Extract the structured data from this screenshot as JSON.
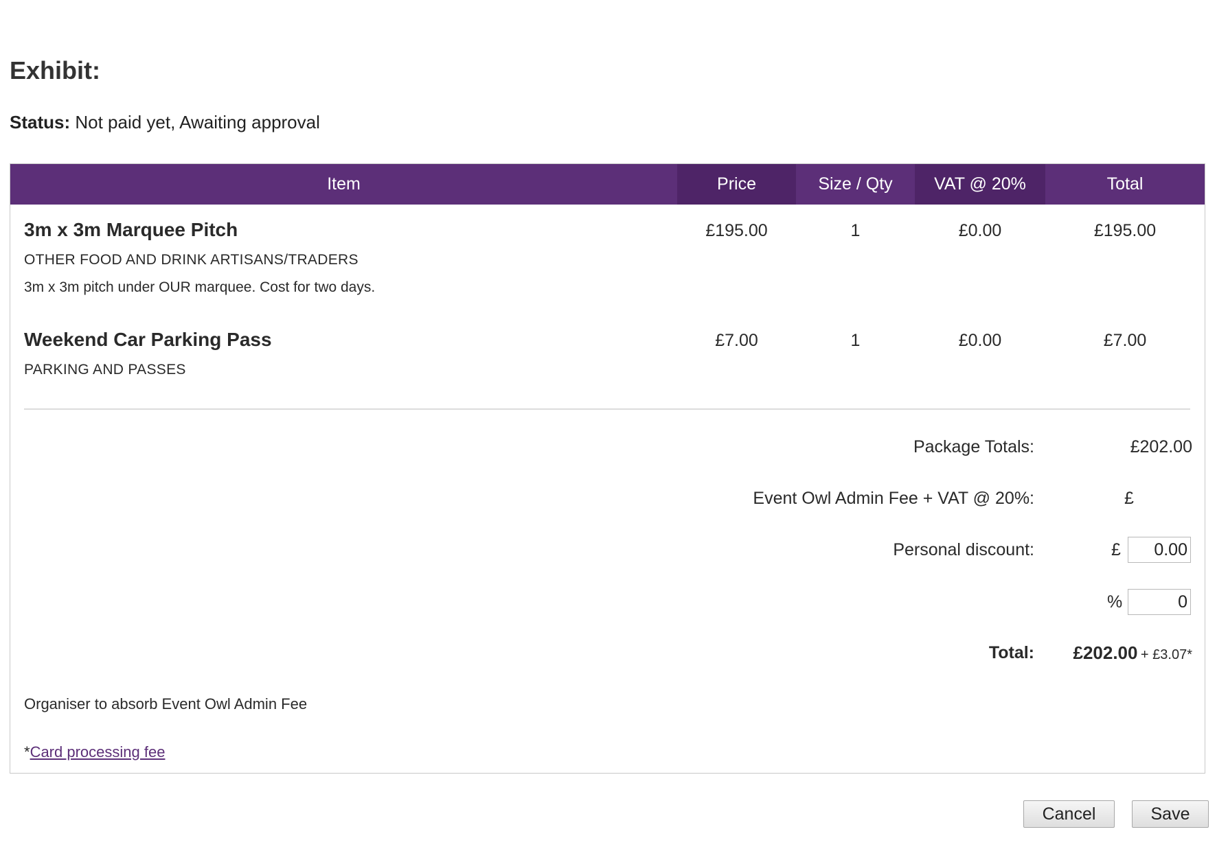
{
  "exhibit": {
    "label": "Exhibit:"
  },
  "status": {
    "label": "Status:",
    "value": "Not paid yet, Awaiting approval"
  },
  "table": {
    "headers": {
      "item": "Item",
      "price": "Price",
      "qty": "Size / Qty",
      "vat": "VAT @ 20%",
      "total": "Total"
    },
    "rows": [
      {
        "name": "3m x 3m Marquee Pitch",
        "category": "OTHER FOOD AND DRINK ARTISANS/TRADERS",
        "description": "3m x 3m pitch under OUR marquee. Cost for two days.",
        "price": "£195.00",
        "qty": "1",
        "vat": "£0.00",
        "total": "£195.00"
      },
      {
        "name": "Weekend Car Parking Pass",
        "category": "PARKING AND PASSES",
        "price": "£7.00",
        "qty": "1",
        "vat": "£0.00",
        "total": "£7.00"
      }
    ]
  },
  "summary": {
    "package_totals_label": "Package Totals:",
    "package_totals_value": "£202.00",
    "admin_fee_label": "Event Owl Admin Fee + VAT @ 20%:",
    "admin_fee_value": "£",
    "discount_label": "Personal discount:",
    "discount_currency_symbol": "£",
    "discount_amount": "0.00",
    "discount_percent_symbol": "%",
    "discount_percent": "0",
    "total_label": "Total:",
    "total_value": "£202.00",
    "total_extra": "+ £3.07*"
  },
  "notes": {
    "absorb_fee": "Organiser to absorb Event Owl Admin Fee",
    "card_fee_prefix": "*",
    "card_fee_link": "Card processing fee"
  },
  "buttons": {
    "cancel": "Cancel",
    "save": "Save"
  },
  "colors": {
    "header_purple": "#5c2f78",
    "header_purple_dark": "#4e2467",
    "link": "#5c2f78"
  }
}
